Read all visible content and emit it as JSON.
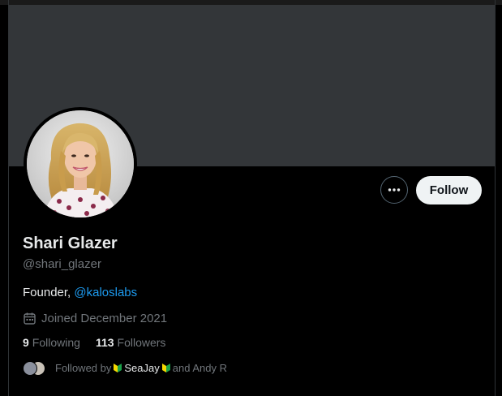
{
  "profile": {
    "display_name": "Shari Glazer",
    "handle": "@shari_glazer",
    "bio_prefix": "Founder, ",
    "bio_mention": "@kaloslabs",
    "joined": "Joined December 2021"
  },
  "actions": {
    "follow_label": "Follow",
    "more_icon": "more-horizontal-icon"
  },
  "stats": {
    "following_count": "9",
    "following_label": "Following",
    "followers_count": "113",
    "followers_label": "Followers"
  },
  "followed_by": {
    "prefix": "Followed by ",
    "name1": "SeaJay",
    "connector": " and Andy R"
  },
  "colors": {
    "background": "#000000",
    "banner": "#333639",
    "primary_text": "#e7e9ea",
    "secondary_text": "#71767b",
    "link": "#1d9bf0",
    "follow_button_bg": "#eff3f4"
  }
}
